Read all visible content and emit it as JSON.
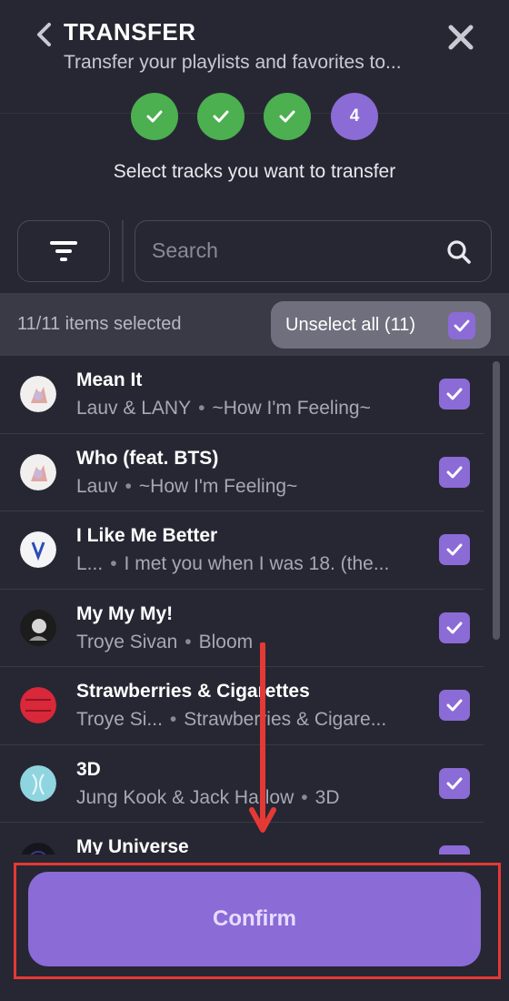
{
  "header": {
    "title": "TRANSFER",
    "subtitle": "Transfer your playlists and favorites to..."
  },
  "stepper": {
    "steps": [
      {
        "state": "done"
      },
      {
        "state": "done"
      },
      {
        "state": "done"
      },
      {
        "state": "current",
        "label": "4"
      }
    ]
  },
  "instructions": "Select tracks you want to transfer",
  "search": {
    "placeholder": "Search",
    "value": ""
  },
  "selection": {
    "count_text": "11/11 items selected",
    "unselect_label": "Unselect all (11)"
  },
  "tracks": [
    {
      "title": "Mean It",
      "artist": "Lauv & LANY",
      "album": "~How I'm Feeling~",
      "checked": true,
      "art_color": "#f2f0ee"
    },
    {
      "title": "Who (feat. BTS)",
      "artist": "Lauv",
      "album": "~How I'm Feeling~",
      "checked": true,
      "art_color": "#f2f0ee"
    },
    {
      "title": "I Like Me Better",
      "artist": "L...",
      "album": "I met you when I was 18. (the...",
      "checked": true,
      "art_color": "#f4f4f6"
    },
    {
      "title": "My My My!",
      "artist": "Troye Sivan",
      "album": "Bloom",
      "checked": true,
      "art_color": "#1c1c1c"
    },
    {
      "title": "Strawberries & Cigarettes",
      "artist": "Troye Si...",
      "album": "Strawberries & Cigare...",
      "checked": true,
      "art_color": "#d8283a"
    },
    {
      "title": "3D",
      "artist": "Jung Kook & Jack Harlow",
      "album": "3D",
      "checked": true,
      "art_color": "#8fd5e0"
    },
    {
      "title": "My Universe",
      "artist": "",
      "album": "",
      "checked": true,
      "art_color": "#15151c"
    }
  ],
  "confirm": {
    "label": "Confirm"
  },
  "colors": {
    "background": "#272733",
    "accent": "#8b6bd6",
    "success": "#4caf50",
    "highlight": "#e53935"
  }
}
